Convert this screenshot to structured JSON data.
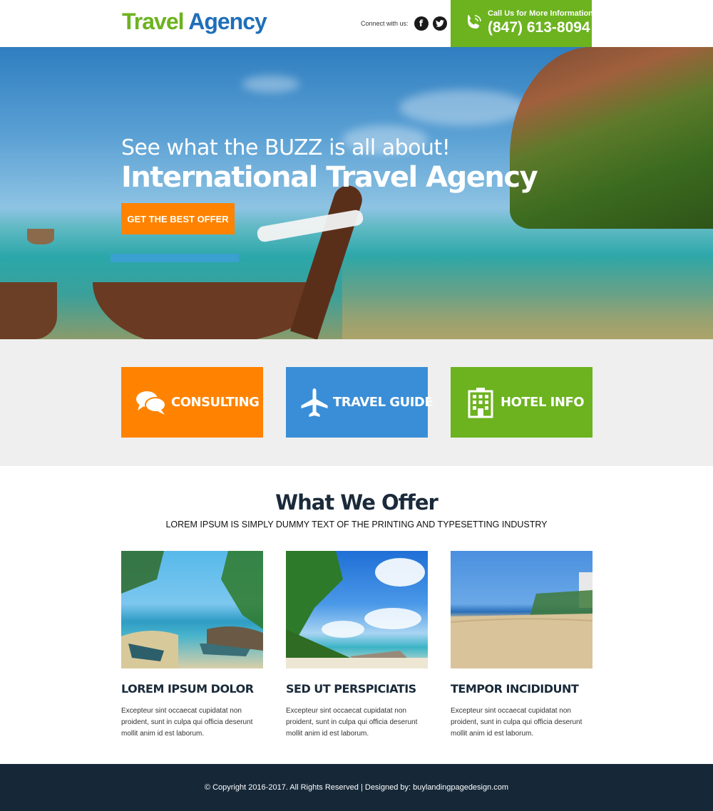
{
  "header": {
    "logo_part1": "Travel",
    "logo_part2": "Agency",
    "connect_label": "Connect with us:",
    "social": [
      {
        "icon": "facebook-icon",
        "glyph": "f"
      },
      {
        "icon": "twitter-icon",
        "glyph": "🐦"
      }
    ],
    "call_label": "Call Us for More Information",
    "call_number": "(847) 613-8094",
    "colors": {
      "green": "#6cb31f",
      "blue": "#1f6fb9"
    }
  },
  "hero": {
    "subtitle": "See what the BUZZ is all about!",
    "title": "International Travel Agency",
    "cta_label": "GET THE BEST OFFER",
    "cta_color": "#ff8300"
  },
  "features": [
    {
      "label": "CONSULTING",
      "icon": "chat-bubbles-icon",
      "color": "#ff8300"
    },
    {
      "label": "TRAVEL GUIDE",
      "icon": "airplane-icon",
      "color": "#3a8ed8"
    },
    {
      "label": "HOTEL INFO",
      "icon": "hotel-building-icon",
      "color": "#6cb31f"
    }
  ],
  "offer": {
    "title": "What We Offer",
    "subtitle": "LOREM IPSUM IS SIMPLY DUMMY TEXT OF THE PRINTING AND TYPESETTING INDUSTRY",
    "cards": [
      {
        "title": "LOREM IPSUM DOLOR",
        "text": "Excepteur sint occaecat cupidatat non proident, sunt in culpa qui officia deserunt mollit anim id est laborum."
      },
      {
        "title": "SED UT PERSPICIATIS",
        "text": "Excepteur sint occaecat cupidatat non proident, sunt in culpa qui officia deserunt mollit anim id est laborum."
      },
      {
        "title": "TEMPOR INCIDIDUNT",
        "text": "Excepteur sint occaecat cupidatat non proident, sunt in culpa qui officia deserunt mollit anim id est laborum."
      }
    ]
  },
  "footer": {
    "text": "© Copyright 2016-2017. All Rights Reserved | Designed by: buylandingpagedesign.com"
  }
}
